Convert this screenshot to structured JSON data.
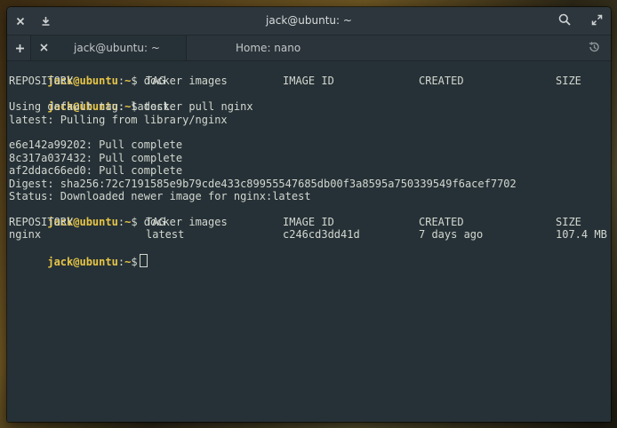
{
  "window": {
    "title": "jack@ubuntu: ~"
  },
  "tabs": [
    {
      "label": "jack@ubuntu: ~",
      "active": true
    },
    {
      "label": "Home: nano",
      "active": false
    }
  ],
  "icons": {
    "close": "close-icon",
    "download": "download-icon",
    "search": "search-icon",
    "maximize": "maximize-icon",
    "new_tab": "plus-icon",
    "close_tab": "close-icon",
    "history": "history-icon"
  },
  "colors": {
    "background": "#263137",
    "prompt": "#e7c547",
    "text": "#d3d7cf"
  },
  "terminal": {
    "prompt": "jack@ubuntu",
    "cwd": "~",
    "symbol": "$",
    "commands": [
      "docker images",
      "docker pull nginx",
      "docker images"
    ],
    "headers": [
      "REPOSITORY",
      "TAG",
      "IMAGE ID",
      "CREATED",
      "SIZE"
    ],
    "pull_output": [
      "Using default tag: latest",
      "latest: Pulling from library/nginx",
      "",
      "e6e142a99202: Pull complete",
      "8c317a037432: Pull complete",
      "af2ddac66ed0: Pull complete",
      "Digest: sha256:72c7191585e9b79cde433c89955547685db00f3a8595a750339549f6acef7702",
      "Status: Downloaded newer image for nginx:latest"
    ],
    "image_row": [
      "nginx",
      "latest",
      "c246cd3dd41d",
      "7 days ago",
      "107.4 MB"
    ]
  }
}
